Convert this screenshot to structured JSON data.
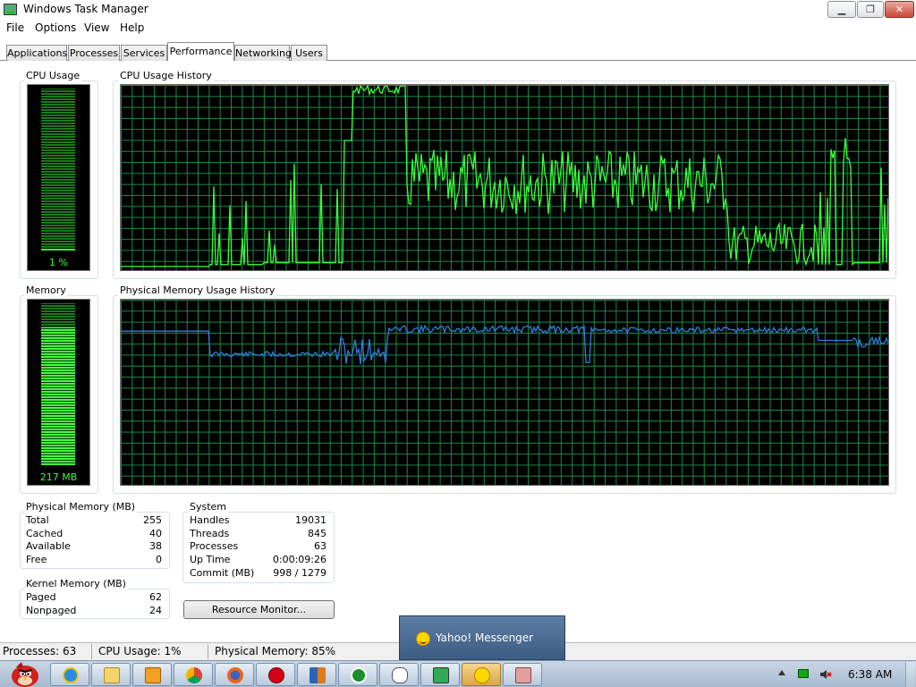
{
  "window": {
    "title": "Windows Task Manager",
    "controls": {
      "minimize": "▁",
      "maximize": "❐",
      "close": "✕"
    }
  },
  "menu": [
    "File",
    "Options",
    "View",
    "Help"
  ],
  "tabs": [
    {
      "label": "Applications"
    },
    {
      "label": "Processes"
    },
    {
      "label": "Services"
    },
    {
      "label": "Performance",
      "active": true
    },
    {
      "label": "Networking"
    },
    {
      "label": "Users"
    }
  ],
  "cpu_usage": {
    "label": "CPU Usage",
    "value_text": "1 %",
    "percent": 1
  },
  "cpu_history": {
    "label": "CPU Usage History"
  },
  "memory": {
    "label": "Memory",
    "value_text": "217 MB",
    "percent": 85
  },
  "memory_history": {
    "label": "Physical Memory Usage History"
  },
  "physical_memory": {
    "title": "Physical Memory (MB)",
    "rows": [
      {
        "label": "Total",
        "value": "255"
      },
      {
        "label": "Cached",
        "value": "40"
      },
      {
        "label": "Available",
        "value": "38"
      },
      {
        "label": "Free",
        "value": "0"
      }
    ]
  },
  "kernel_memory": {
    "title": "Kernel Memory (MB)",
    "rows": [
      {
        "label": "Paged",
        "value": "62"
      },
      {
        "label": "Nonpaged",
        "value": "24"
      }
    ]
  },
  "system": {
    "title": "System",
    "rows": [
      {
        "label": "Handles",
        "value": "19031"
      },
      {
        "label": "Threads",
        "value": "845"
      },
      {
        "label": "Processes",
        "value": "63"
      },
      {
        "label": "Up Time",
        "value": "0:00:09:26"
      },
      {
        "label": "Commit (MB)",
        "value": "998 / 1279"
      }
    ]
  },
  "resource_monitor_button": "Resource Monitor...",
  "status_bar": {
    "processes": "Processes: 63",
    "cpu": "CPU Usage: 1%",
    "memory": "Physical Memory: 85%"
  },
  "notification": {
    "text": "Yahoo! Messenger"
  },
  "taskbar": {
    "clock": "6:38 AM",
    "icons": [
      "internet-explorer-icon",
      "folder-icon",
      "media-player-icon",
      "chrome-icon",
      "firefox-icon",
      "opera-icon",
      "app-icon",
      "utorrent-icon",
      "messenger-icon",
      "task-manager-icon",
      "yahoo-messenger-icon",
      "paint-icon"
    ]
  },
  "colors": {
    "cpu_line": "#3cff3c",
    "memory_line": "#2f7fe0",
    "graph_grid": "#1e8a46"
  }
}
